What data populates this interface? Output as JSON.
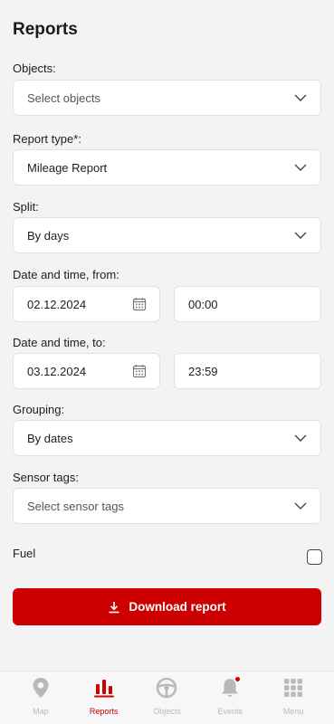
{
  "page": {
    "title": "Reports"
  },
  "form": {
    "objects": {
      "label": "Objects:",
      "placeholder": "Select objects"
    },
    "report_type": {
      "label": "Report type*:",
      "value": "Mileage Report"
    },
    "split": {
      "label": "Split:",
      "value": "By days"
    },
    "date_from": {
      "label": "Date and time, from:",
      "date": "02.12.2024",
      "time": "00:00"
    },
    "date_to": {
      "label": "Date and time, to:",
      "date": "03.12.2024",
      "time": "23:59"
    },
    "grouping": {
      "label": "Grouping:",
      "value": "By dates"
    },
    "sensor_tags": {
      "label": "Sensor tags:",
      "placeholder": "Select sensor tags"
    },
    "fuel": {
      "label": "Fuel",
      "checked": false
    },
    "download_label": "Download report"
  },
  "tabbar": {
    "items": [
      {
        "label": "Map",
        "icon": "map-pin-icon",
        "active": false
      },
      {
        "label": "Reports",
        "icon": "bar-chart-icon",
        "active": true
      },
      {
        "label": "Objects",
        "icon": "steering-wheel-icon",
        "active": false
      },
      {
        "label": "Events",
        "icon": "bell-icon",
        "active": false,
        "badge": true
      },
      {
        "label": "Menu",
        "icon": "grid-icon",
        "active": false
      }
    ]
  },
  "colors": {
    "accent": "#cc0000",
    "background": "#f3f3f3",
    "inactive": "#b9b9b9"
  }
}
